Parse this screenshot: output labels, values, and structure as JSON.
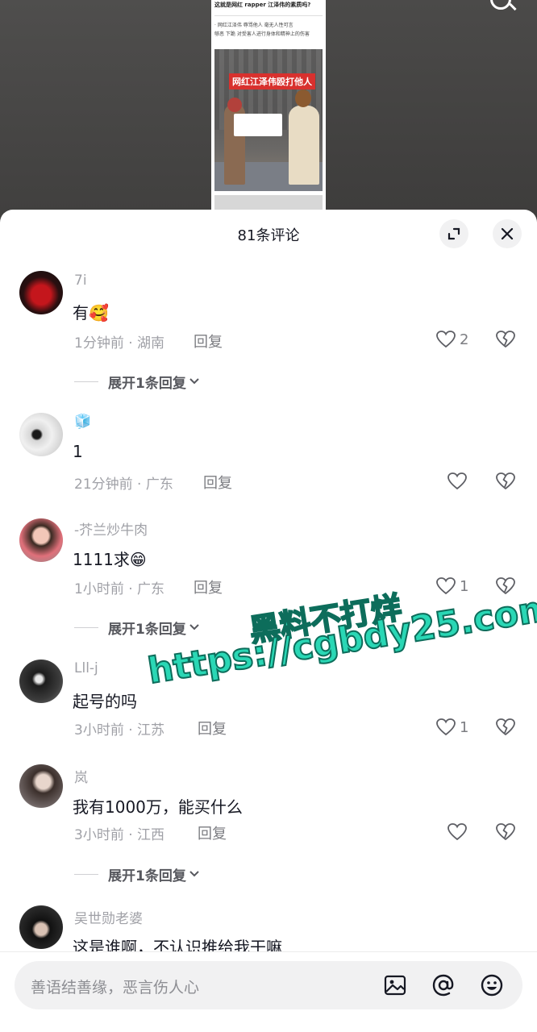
{
  "video": {
    "article_title": "这就是网红 rapper 江泽伟的素质吗?",
    "article_text_1": "· 网红江泽伟 辱骂他人 毫无人性可言",
    "article_text_2": "够恶 下跪 对受害人进行身体和精神上的伤害",
    "photo_caption": "网红江泽伟殴打他人"
  },
  "sheet": {
    "title": "81条评论",
    "expand_icon": "expand-icon",
    "close_icon": "close-icon"
  },
  "comments": [
    {
      "username": "7i",
      "text": "有",
      "emoji": "🥰",
      "time": "1分钟前 · 湖南",
      "reply_label": "回复",
      "likes": "2",
      "expand": "展开1条回复"
    },
    {
      "username": "🧊",
      "text": "1",
      "time": "21分钟前 · 广东",
      "reply_label": "回复",
      "likes": ""
    },
    {
      "username": "-芥兰炒牛肉",
      "text": "1111求",
      "emoji": "😁",
      "time": "1小时前 · 广东",
      "reply_label": "回复",
      "likes": "1",
      "expand": "展开1条回复"
    },
    {
      "username": "Lll-j",
      "text": "起号的吗",
      "time": "3小时前 · 江苏",
      "reply_label": "回复",
      "likes": "1"
    },
    {
      "username": "岚",
      "text": "我有1000万，能买什么",
      "time": "3小时前 · 江西",
      "reply_label": "回复",
      "likes": "",
      "expand": "展开1条回复"
    },
    {
      "username": "吴世勋老婆",
      "text": "这是谁啊，不认识推给我干嘛"
    }
  ],
  "watermark": {
    "line1": "黑料不打烊",
    "line2": "https://cgbdy25.com"
  },
  "input": {
    "placeholder": "善语结善缘，恶言伤人心",
    "image_icon": "image-icon",
    "mention_icon": "at-mention-icon",
    "emoji_icon": "emoji-icon"
  },
  "colors": {
    "text_primary": "#161823",
    "text_secondary": "#a0a1a7",
    "watermark": "#2ad7b5",
    "sheet_bg": "#ffffff"
  }
}
